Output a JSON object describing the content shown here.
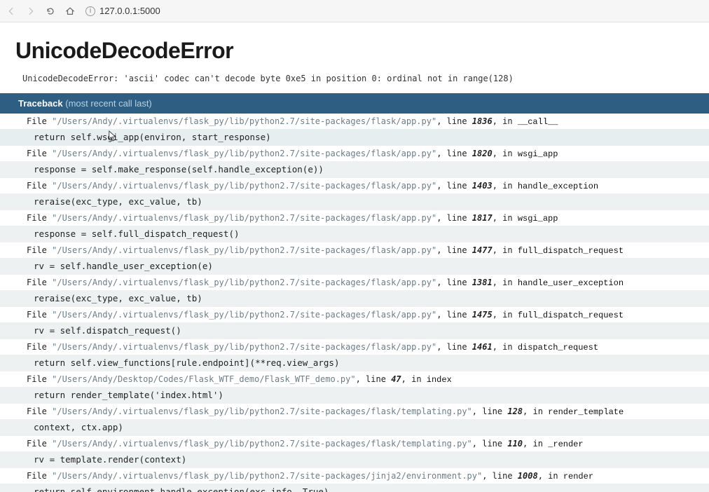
{
  "browser": {
    "url": "127.0.0.1:5000"
  },
  "error": {
    "title": "UnicodeDecodeError",
    "message": "UnicodeDecodeError: 'ascii' codec can't decode byte 0xe5 in position 0: ordinal not in range(128)"
  },
  "traceback": {
    "label": "Traceback",
    "sub": "(most recent call last)",
    "file_label": "File",
    "line_label": ", line ",
    "in_label": ", in "
  },
  "frames": [
    {
      "path": "\"/Users/Andy/.virtualenvs/flask_py/lib/python2.7/site-packages/flask/app.py\"",
      "lineno": "1836",
      "func": "__call__",
      "code": "return self.wsgi_app(environ, start_response)",
      "highlight": true,
      "cursor": true
    },
    {
      "path": "\"/Users/Andy/.virtualenvs/flask_py/lib/python2.7/site-packages/flask/app.py\"",
      "lineno": "1820",
      "func": "wsgi_app",
      "code": "response = self.make_response(self.handle_exception(e))"
    },
    {
      "path": "\"/Users/Andy/.virtualenvs/flask_py/lib/python2.7/site-packages/flask/app.py\"",
      "lineno": "1403",
      "func": "handle_exception",
      "code": "reraise(exc_type, exc_value, tb)"
    },
    {
      "path": "\"/Users/Andy/.virtualenvs/flask_py/lib/python2.7/site-packages/flask/app.py\"",
      "lineno": "1817",
      "func": "wsgi_app",
      "code": "response = self.full_dispatch_request()"
    },
    {
      "path": "\"/Users/Andy/.virtualenvs/flask_py/lib/python2.7/site-packages/flask/app.py\"",
      "lineno": "1477",
      "func": "full_dispatch_request",
      "code": "rv = self.handle_user_exception(e)"
    },
    {
      "path": "\"/Users/Andy/.virtualenvs/flask_py/lib/python2.7/site-packages/flask/app.py\"",
      "lineno": "1381",
      "func": "handle_user_exception",
      "code": "reraise(exc_type, exc_value, tb)"
    },
    {
      "path": "\"/Users/Andy/.virtualenvs/flask_py/lib/python2.7/site-packages/flask/app.py\"",
      "lineno": "1475",
      "func": "full_dispatch_request",
      "code": "rv = self.dispatch_request()"
    },
    {
      "path": "\"/Users/Andy/.virtualenvs/flask_py/lib/python2.7/site-packages/flask/app.py\"",
      "lineno": "1461",
      "func": "dispatch_request",
      "code": "return self.view_functions[rule.endpoint](**req.view_args)"
    },
    {
      "path": "\"/Users/Andy/Desktop/Codes/Flask_WTF_demo/Flask_WTF_demo.py\"",
      "lineno": "47",
      "func": "index",
      "code": "return render_template('index.html')"
    },
    {
      "path": "\"/Users/Andy/.virtualenvs/flask_py/lib/python2.7/site-packages/flask/templating.py\"",
      "lineno": "128",
      "func": "render_template",
      "code": "context, ctx.app)"
    },
    {
      "path": "\"/Users/Andy/.virtualenvs/flask_py/lib/python2.7/site-packages/flask/templating.py\"",
      "lineno": "110",
      "func": "_render",
      "code": "rv = template.render(context)"
    },
    {
      "path": "\"/Users/Andy/.virtualenvs/flask_py/lib/python2.7/site-packages/jinja2/environment.py\"",
      "lineno": "1008",
      "func": "render",
      "code": "return self.environment.handle_exception(exc_info, True)"
    }
  ]
}
